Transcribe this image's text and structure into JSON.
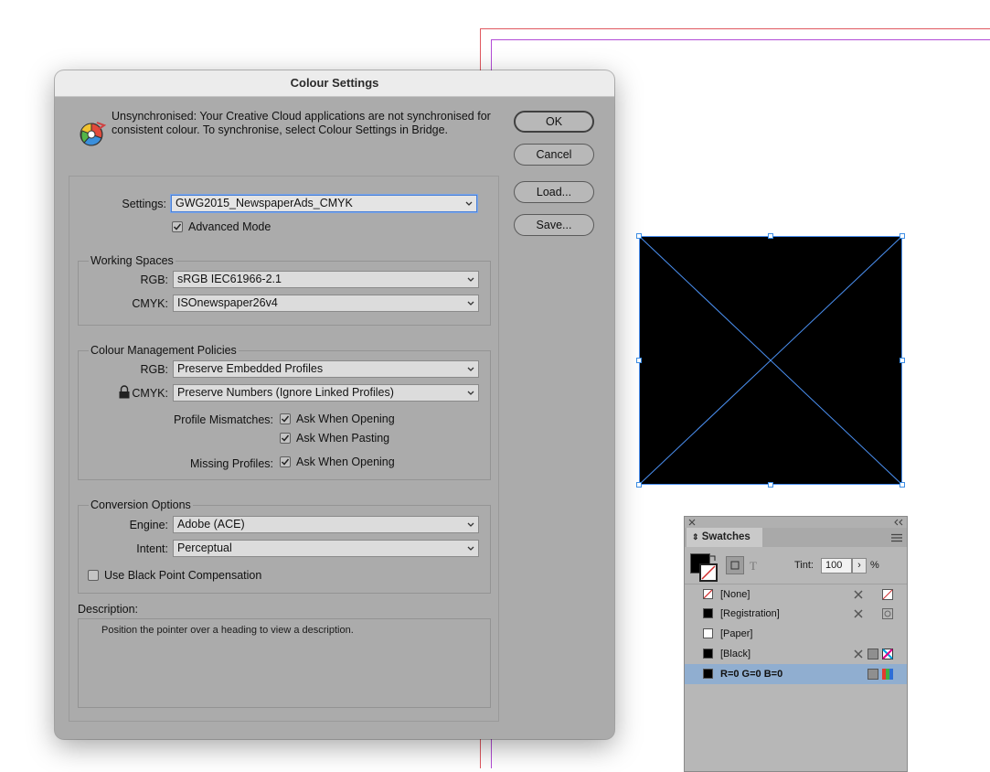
{
  "dialog": {
    "title": "Colour Settings",
    "sync_message": "Unsynchronised: Your Creative Cloud applications are not synchronised for consistent colour. To synchronise, select Colour Settings in Bridge.",
    "buttons": {
      "ok": "OK",
      "cancel": "Cancel",
      "load": "Load...",
      "save": "Save..."
    },
    "settings_label": "Settings:",
    "settings_value": "GWG2015_NewspaperAds_CMYK",
    "advanced_mode_label": "Advanced Mode",
    "advanced_mode_checked": true,
    "working_spaces": {
      "title": "Working Spaces",
      "rgb_label": "RGB:",
      "rgb_value": "sRGB IEC61966-2.1",
      "cmyk_label": "CMYK:",
      "cmyk_value": "ISOnewspaper26v4"
    },
    "policies": {
      "title": "Colour Management Policies",
      "rgb_label": "RGB:",
      "rgb_value": "Preserve Embedded Profiles",
      "cmyk_label": "CMYK:",
      "cmyk_value": "Preserve Numbers (Ignore Linked Profiles)",
      "mismatches_label": "Profile Mismatches:",
      "ask_opening": "Ask When Opening",
      "ask_pasting": "Ask When Pasting",
      "missing_label": "Missing Profiles:",
      "missing_ask_opening": "Ask When Opening"
    },
    "conversion": {
      "title": "Conversion Options",
      "engine_label": "Engine:",
      "engine_value": "Adobe (ACE)",
      "intent_label": "Intent:",
      "intent_value": "Perceptual",
      "bpc_label": "Use Black Point Compensation",
      "bpc_checked": false
    },
    "description": {
      "label": "Description:",
      "text": "Position the pointer over a heading to view a description."
    }
  },
  "swatches": {
    "tab_label": "Swatches",
    "tint_label": "Tint:",
    "tint_value": "100",
    "percent": "%",
    "items": [
      {
        "name": "[None]",
        "chip": "none"
      },
      {
        "name": "[Registration]",
        "chip": "#000000"
      },
      {
        "name": "[Paper]",
        "chip": "#ffffff"
      },
      {
        "name": "[Black]",
        "chip": "#000000"
      },
      {
        "name": "R=0 G=0 B=0",
        "chip": "#000000",
        "selected": true
      }
    ]
  }
}
